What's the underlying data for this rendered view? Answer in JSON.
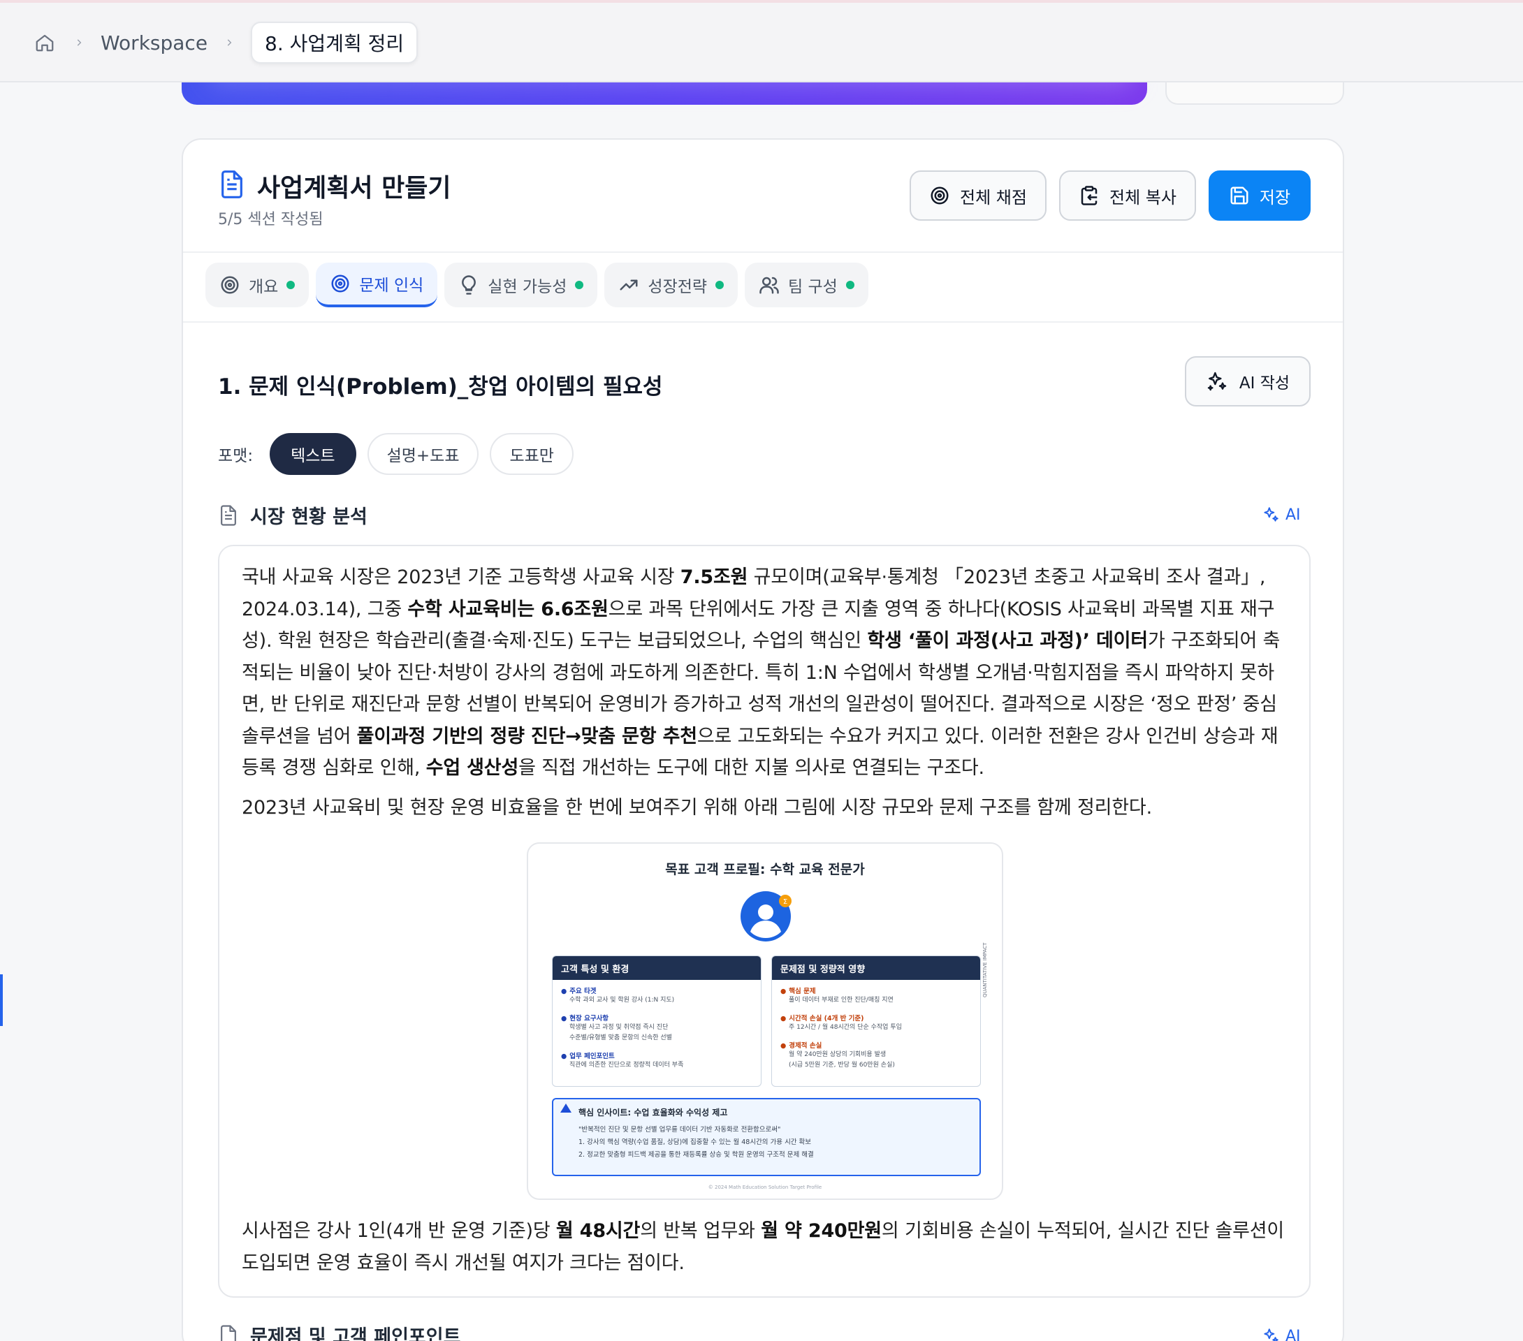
{
  "breadcrumb": {
    "home_icon": "home-icon",
    "items": [
      "Workspace"
    ],
    "current": "8. 사업계획 정리"
  },
  "header": {
    "title": "사업계획서 만들기",
    "subtitle": "5/5 섹션 작성됨",
    "buttons": {
      "grade_all": "전체 채점",
      "copy_all": "전체 복사",
      "save": "저장"
    }
  },
  "tabs": [
    {
      "label": "개요",
      "icon": "target-icon",
      "status": "done",
      "active": false
    },
    {
      "label": "문제 인식",
      "icon": "target-icon",
      "status": "",
      "active": true
    },
    {
      "label": "실현 가능성",
      "icon": "lightbulb-icon",
      "status": "done",
      "active": false
    },
    {
      "label": "성장전략",
      "icon": "trending-up-icon",
      "status": "done",
      "active": false
    },
    {
      "label": "팀 구성",
      "icon": "users-icon",
      "status": "done",
      "active": false
    }
  ],
  "section": {
    "title": "1. 문제 인식(Problem)_창업 아이템의 필요성",
    "ai_write": "AI 작성",
    "format_label": "포맷:",
    "formats": [
      "텍스트",
      "설명+도표",
      "도표만"
    ],
    "format_selected": "텍스트"
  },
  "subsection": {
    "title": "시장 현황 분석",
    "ai_label": "AI",
    "paragraph1": [
      {
        "t": "국내 사교육 시장은 2023년 기준 고등학생 사교육 시장 "
      },
      {
        "t": "7.5조원",
        "b": true
      },
      {
        "t": " 규모이며(교육부·통계청 「2023년 초중고 사교육비 조사 결과」, 2024.03.14), 그중 "
      },
      {
        "t": "수학 사교육비는 6.6조원",
        "b": true
      },
      {
        "t": "으로 과목 단위에서도 가장 큰 지출 영역 중 하나다(KOSIS 사교육비 과목별 지표 재구성). 학원 현장은 학습관리(출결·숙제·진도) 도구는 보급되었으나, 수업의 핵심인 "
      },
      {
        "t": "학생 ‘풀이 과정(사고 과정)’ 데이터",
        "b": true
      },
      {
        "t": "가 구조화되어 축적되는 비율이 낮아 진단·처방이 강사의 경험에 과도하게 의존한다. 특히 1:N 수업에서 학생별 오개념·막힘지점을 즉시 파악하지 못하면, 반 단위로 재진단과 문항 선별이 반복되어 운영비가 증가하고 성적 개선의 일관성이 떨어진다. 결과적으로 시장은 ‘정오 판정’ 중심 솔루션을 넘어 "
      },
      {
        "t": "풀이과정 기반의 정량 진단→맞춤 문항 추천",
        "b": true
      },
      {
        "t": "으로 고도화되는 수요가 커지고 있다. 이러한 전환은 강사 인건비 상승과 재등록 경쟁 심화로 인해, "
      },
      {
        "t": "수업 생산성",
        "b": true
      },
      {
        "t": "을 직접 개선하는 도구에 대한 지불 의사로 연결되는 구조다."
      }
    ],
    "paragraph2": "2023년 사교육비 및 현장 운영 비효율을 한 번에 보여주기 위해 아래 그림에 시장 규모와 문제 구조를 함께 정리한다.",
    "paragraph3": [
      {
        "t": "시사점은 강사 1인(4개 반 운영 기준)당 "
      },
      {
        "t": "월 48시간",
        "b": true
      },
      {
        "t": "의 반복 업무와 "
      },
      {
        "t": "월 약 240만원",
        "b": true
      },
      {
        "t": "의 기회비용 손실이 누적되어, 실시간 진단 솔루션이 도입되면 운영 효율이 즉시 개선될 여지가 크다는 점이다."
      }
    ]
  },
  "figure": {
    "title": "목표 고객 프로필: 수학 교육 전문가",
    "left_box": {
      "header": "고객 특성 및 환경",
      "items": [
        {
          "key": "주요 타겟",
          "lines": [
            "수학 과외 교사 및 학원 강사 (1:N 지도)"
          ]
        },
        {
          "key": "현장 요구사항",
          "lines": [
            "학생별 사고 과정 및 취약점 즉시 진단",
            "수준별/유형별 맞춤 문항의 신속한 선별"
          ]
        },
        {
          "key": "업무 페인포인트",
          "lines": [
            "직관에 의존한 진단으로 정량적 데이터 부족"
          ]
        }
      ]
    },
    "right_box": {
      "header": "문제점 및 정량적 영향",
      "items": [
        {
          "key": "핵심 문제",
          "lines": [
            "풀이 데이터 부재로 인한 진단/매칭 지연"
          ]
        },
        {
          "key": "시간적 손실 (4개 반 기준)",
          "lines": [
            "주 12시간 / 월 48시간의 단순 수작업 투입"
          ]
        },
        {
          "key": "경제적 손실",
          "lines": [
            "월 약 240만원 상당의 기회비용 발생",
            "(시급 5만원 기준, 반당 월 60만원 손실)"
          ]
        }
      ]
    },
    "side_label": "QUANTITATIVE IMPACT",
    "insight": {
      "title": "핵심 인사이트: 수업 효율화와 수익성 제고",
      "lines": [
        "\"반복적인 진단 및 문항 선별 업무를 데이터 기반 자동화로 전환함으로써\"",
        "1. 강사의 핵심 역량(수업 품질, 상담)에 집중할 수 있는 월 48시간의 가용 시간 확보",
        "2. 정교한 맞춤형 피드백 제공을 통한 재등록률 상승 및 학원 운영의 구조적 문제 해결"
      ]
    },
    "footer": "© 2024 Math Education Solution Target Profile"
  },
  "next_subsection": {
    "title": "문제점 및 고객 페인포인트",
    "ai_label": "AI"
  },
  "colors": {
    "primary": "#0b84f5",
    "accent_blue": "#2563eb",
    "status_green": "#10b981",
    "dark_pill": "#1f2a44",
    "gradient_start": "#4453ef",
    "gradient_end": "#7c3aed"
  }
}
